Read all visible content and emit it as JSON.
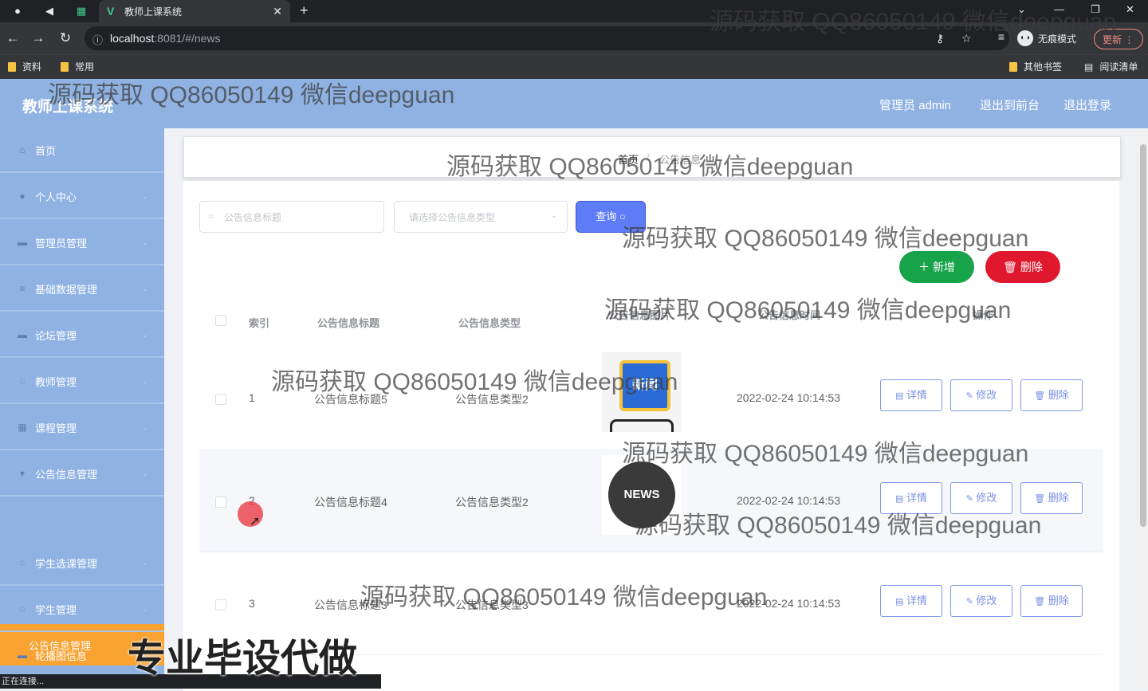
{
  "browser": {
    "tab_title": "教师上课系统",
    "url_host": "localhost",
    "url_rest": ":8081/#/news",
    "incognito_label": "无痕模式",
    "update_label": "更新",
    "bookmarks": [
      "资料",
      "常用"
    ],
    "other_bookmarks": "其他书签",
    "reading_list": "阅读清单",
    "status_text": "正在连接..."
  },
  "header": {
    "brand": "教师上课系统",
    "admin_label": "管理员 admin",
    "to_front": "退出到前台",
    "logout": "退出登录"
  },
  "sidebar": {
    "items": [
      {
        "label": "首页",
        "icon": "home-icon"
      },
      {
        "label": "个人中心",
        "icon": "user-icon"
      },
      {
        "label": "管理员管理",
        "icon": "admin-icon"
      },
      {
        "label": "基础数据管理",
        "icon": "list-icon"
      },
      {
        "label": "论坛管理",
        "icon": "forum-icon"
      },
      {
        "label": "教师管理",
        "icon": "teacher-icon"
      },
      {
        "label": "课程管理",
        "icon": "course-icon"
      },
      {
        "label": "公告信息管理",
        "icon": "notice-icon"
      },
      {
        "label": "学生选课管理",
        "icon": "select-icon"
      },
      {
        "label": "学生管理",
        "icon": "student-icon"
      },
      {
        "label": "轮播图信息",
        "icon": "carousel-icon"
      }
    ],
    "active_sub": "公告信息管理"
  },
  "breadcrumb": {
    "home": "首页",
    "sep": "/",
    "current": "公告信息"
  },
  "search": {
    "title_placeholder": "公告信息标题",
    "type_placeholder": "请选择公告信息类型",
    "query_label": "查询"
  },
  "actions": {
    "add": "新增",
    "delete": "删除"
  },
  "table": {
    "headers": {
      "index": "索引",
      "title": "公告信息标题",
      "type": "公告信息类型",
      "image": "公告信息图片",
      "time": "公告信息时间",
      "ops": "操作"
    },
    "rows": [
      {
        "index": "1",
        "title": "公告信息标题5",
        "type": "公告信息类型2",
        "time": "2022-02-24 10:14:53",
        "image_text": "新闻"
      },
      {
        "index": "2",
        "title": "公告信息标题4",
        "type": "公告信息类型2",
        "time": "2022-02-24 10:14:53",
        "image_text": "NEWS"
      },
      {
        "index": "3",
        "title": "公告信息标题3",
        "type": "公告信息类型3",
        "time": "2022-02-24 10:14:53",
        "image_text": ""
      }
    ],
    "row_buttons": {
      "detail": "详情",
      "edit": "修改",
      "delete": "删除"
    }
  },
  "watermark": "源码获取 QQ86050149 微信deepguan",
  "promo": "专业毕设代做",
  "colors": {
    "header_bg": "#8fb2e3",
    "active_menu": "#f8a331",
    "query_btn": "#5d7cf5",
    "add_btn": "#17a34a",
    "delete_btn": "#e0182d"
  }
}
